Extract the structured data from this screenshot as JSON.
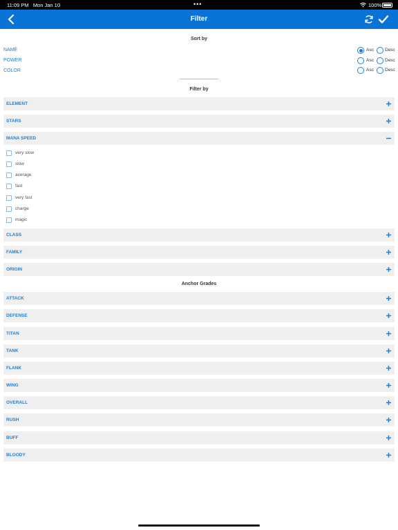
{
  "status": {
    "time": "11:09 PM",
    "date": "Mon Jan 10",
    "dots": "•••",
    "battery": "100%"
  },
  "nav": {
    "title": "Filter",
    "back_icon": "chevron-left-icon",
    "refresh_icon": "refresh-icon",
    "done_icon": "checkmark-icon"
  },
  "sort": {
    "title": "Sort by",
    "asc_label": "Asc",
    "desc_label": "Desc",
    "rows": [
      {
        "label": "NAME",
        "selected": "Asc"
      },
      {
        "label": "POWER",
        "selected": null
      },
      {
        "label": "COLOR",
        "selected": null
      }
    ]
  },
  "filter": {
    "title": "Filter by",
    "sections": [
      {
        "label": "ELEMENT",
        "expanded": false
      },
      {
        "label": "STARS",
        "expanded": false
      },
      {
        "label": "MANA SPEED",
        "expanded": true,
        "options": [
          "very slow",
          "slow",
          "average",
          "fast",
          "very fast",
          "charge",
          "magic"
        ]
      },
      {
        "label": "CLASS",
        "expanded": false
      },
      {
        "label": "FAMILY",
        "expanded": false
      },
      {
        "label": "ORIGIN",
        "expanded": false
      }
    ]
  },
  "anchor": {
    "title": "Anchor Grades",
    "sections": [
      "ATTACK",
      "DEFENSE",
      "TITAN",
      "TANK",
      "FLANK",
      "WING",
      "OVERALL",
      "RUSH",
      "BUFF",
      "BLOODY"
    ]
  },
  "colors": {
    "accent": "#0a74d6",
    "link": "#1f7ed0",
    "row_bg": "#efefef"
  }
}
